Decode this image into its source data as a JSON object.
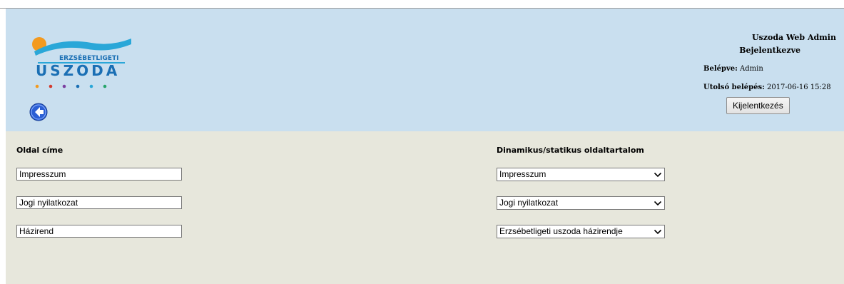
{
  "header": {
    "app_title": "Uszoda Web Admin",
    "login_status": "Bejelentkezve",
    "logged_in_label": "Belépve:",
    "logged_in_user": "Admin",
    "last_login_label": "Utolsó belépés:",
    "last_login_value": "2017-06-16 15:28",
    "logout_label": "Kijelentkezés",
    "logo_text_top": "ERZSÉBETLIGETI",
    "logo_text_main": "USZODA",
    "back_icon": "back-arrow-icon"
  },
  "columns": {
    "left_title": "Oldal címe",
    "right_title": "Dinamikus/statikus oldaltartalom"
  },
  "rows": [
    {
      "title_value": "Impresszum",
      "content_selected": "Impresszum"
    },
    {
      "title_value": "Jogi nyilatkozat",
      "content_selected": "Jogi nyilatkozat"
    },
    {
      "title_value": "Házirend",
      "content_selected": "Erzsébetligeti uszoda házirendje"
    }
  ],
  "colors": {
    "header_bg": "#c9dfef",
    "content_bg": "#e7e7dc",
    "logo_blue": "#1a6fb4",
    "logo_orange": "#f39a1f",
    "logo_cyan": "#2aa7d8"
  }
}
